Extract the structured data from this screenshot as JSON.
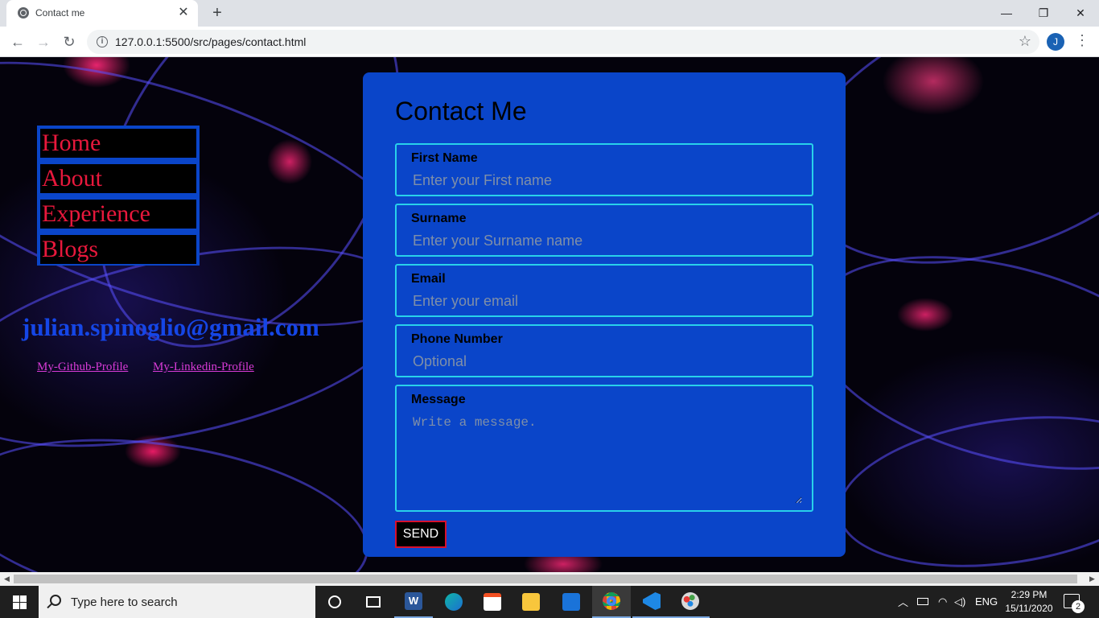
{
  "browser": {
    "tab_title": "Contact me",
    "tab_close": "✕",
    "new_tab": "+",
    "url": "127.0.0.1:5500/src/pages/contact.html",
    "profile_initial": "J",
    "window_minimize": "—",
    "window_restore": "❐",
    "window_close": "✕",
    "back": "←",
    "forward": "→",
    "reload": "↻",
    "info": "i",
    "bookmark": "☆",
    "menu": "⋮"
  },
  "sidebar": {
    "nav_items": [
      {
        "label": "Home"
      },
      {
        "label": "About"
      },
      {
        "label": "Experience"
      },
      {
        "label": "Blogs"
      }
    ],
    "email": "julian.spinoglio@gmail.com",
    "github_link": "My-Github-Profile",
    "linkedin_link": "My-Linkedin-Profile"
  },
  "form": {
    "title": "Contact Me",
    "fields": [
      {
        "label": "First Name",
        "placeholder": "Enter your First name"
      },
      {
        "label": "Surname",
        "placeholder": "Enter your Surname name"
      },
      {
        "label": "Email",
        "placeholder": "Enter your email"
      },
      {
        "label": "Phone Number",
        "placeholder": "Optional"
      }
    ],
    "message": {
      "label": "Message",
      "placeholder": "Write a message."
    },
    "send_label": "SEND"
  },
  "scrollbar": {
    "left": "◀",
    "right": "▶"
  },
  "taskbar": {
    "search_placeholder": "Type here to search",
    "language": "ENG",
    "time": "2:29 PM",
    "date": "15/11/2020",
    "notification_count": "2",
    "word_letter": "W",
    "apps": [
      "cortana-icon",
      "task-view-icon",
      "word-icon",
      "edge-icon",
      "store-icon",
      "file-explorer-icon",
      "mail-icon",
      "chrome-icon",
      "vscode-icon",
      "paint-icon"
    ]
  },
  "colors": {
    "card": "#0a45c9",
    "field_border": "#28d1ea",
    "nav_text": "#e8183c",
    "email_text": "#1546e6",
    "link_text": "#d73bd6",
    "send_border": "#d8102e"
  }
}
